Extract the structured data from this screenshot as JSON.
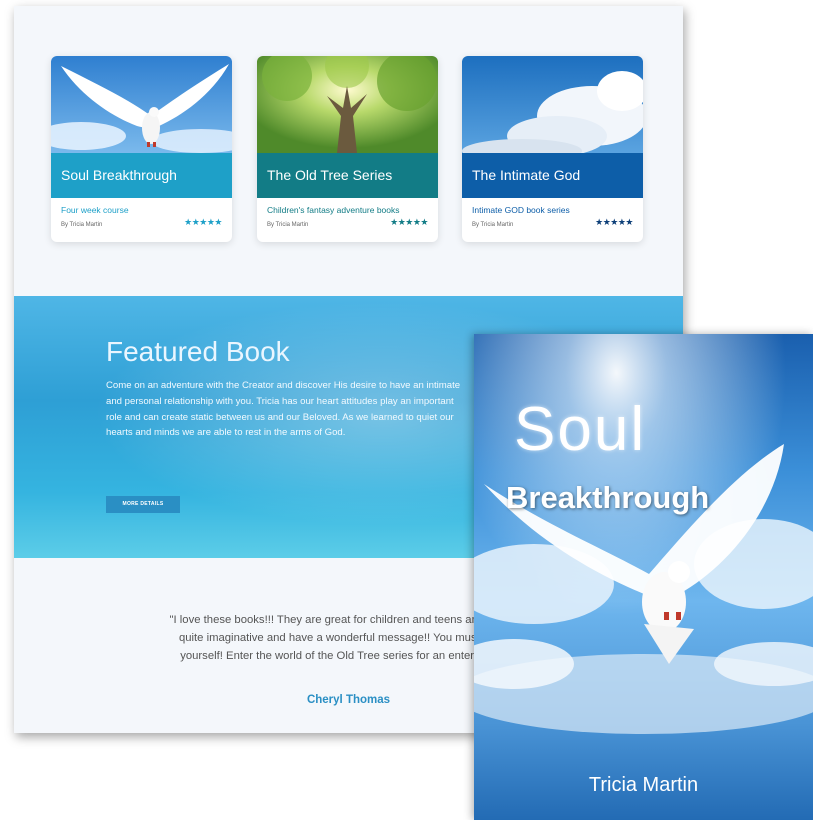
{
  "cards": [
    {
      "title": "Soul  Breakthrough",
      "subtitle": "Four week course",
      "byline": "By Tricia Martin",
      "stars": "★★★★★",
      "bar_color": "#1ea0c8",
      "subtitle_color": "#1ea0c8",
      "star_color": "#1ea0c8"
    },
    {
      "title": "The Old Tree Series",
      "subtitle": "Children's fantasy adventure books",
      "byline": "By Tricia Martin",
      "stars": "★★★★★",
      "bar_color": "#127c86",
      "subtitle_color": "#127c86",
      "star_color": "#127c86"
    },
    {
      "title": "The Intimate God",
      "subtitle": "Intimate GOD book series",
      "byline": "By Tricia Martin",
      "stars": "★★★★★",
      "bar_color": "#0d5ea8",
      "subtitle_color": "#0d5ea8",
      "star_color": "#0d3f78"
    }
  ],
  "featured": {
    "heading": "Featured Book",
    "body": "Come on an adventure with the Creator and discover His desire to have an intimate and personal relationship with you. Tricia has our heart attitudes play an important role and can create static between us and our Beloved. As we learned to quiet our hearts and minds we are able to rest in the arms of God.",
    "button": "MORE DETAILS"
  },
  "testimonial": {
    "lines": [
      "\"I love these books!!! They are great for children and teens and even ad",
      "quite imaginative and have a wonderful message!! You must read th",
      "yourself! Enter the world of the Old Tree series for an entertaining a"
    ],
    "author": "Cheryl Thomas"
  },
  "book_cover": {
    "title_line1": "Soul",
    "title_line2": "Breakthrough",
    "author": "Tricia Martin"
  }
}
